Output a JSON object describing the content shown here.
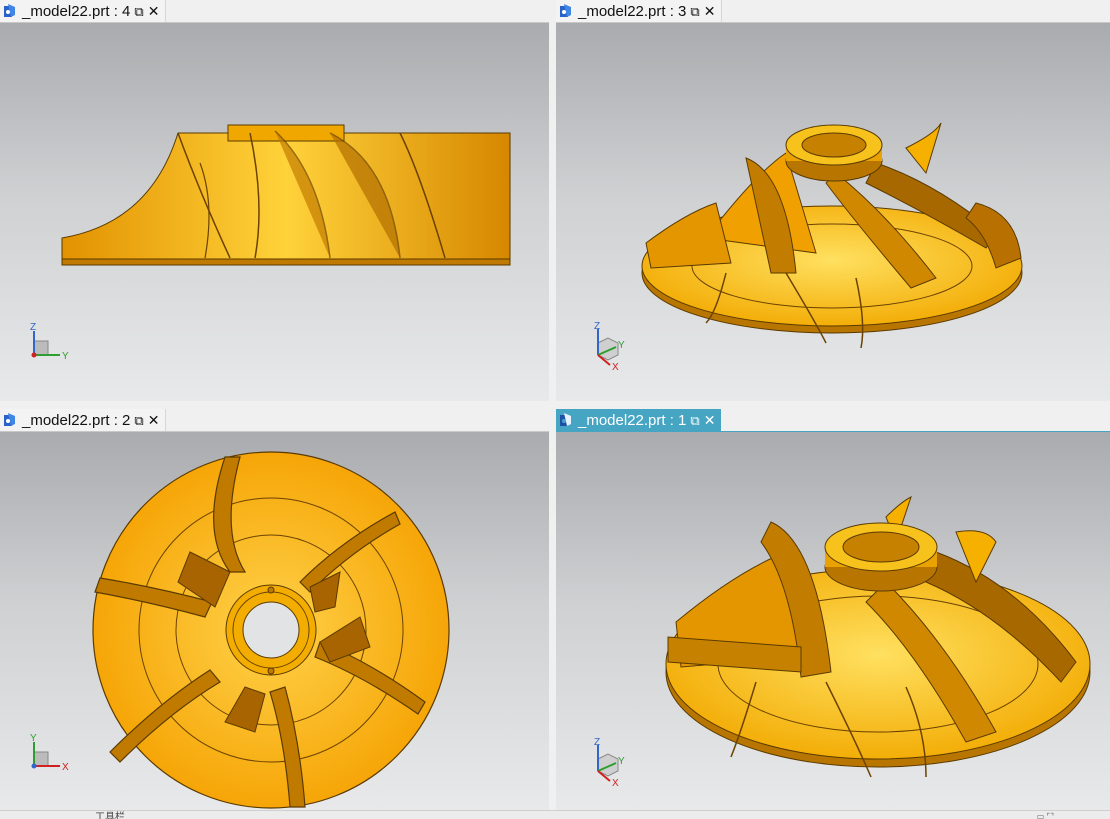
{
  "panes": [
    {
      "tab_title": "_model22.prt : 4",
      "active": false,
      "view": "side",
      "triad_axes": [
        "Z",
        "Y"
      ]
    },
    {
      "tab_title": "_model22.prt : 3",
      "active": false,
      "view": "iso",
      "triad_axes": [
        "Z",
        "Y",
        "X"
      ]
    },
    {
      "tab_title": "_model22.prt : 2",
      "active": false,
      "view": "top",
      "triad_axes": [
        "Y",
        "X"
      ]
    },
    {
      "tab_title": "_model22.prt : 1",
      "active": true,
      "view": "iso",
      "triad_axes": [
        "Z",
        "Y",
        "X"
      ]
    }
  ],
  "icons": {
    "document": "part-document-icon",
    "popout": "popout-icon",
    "close": "close-icon"
  },
  "colors": {
    "active_tab": "#46a5c2",
    "model_gold": "#f5b800",
    "model_shadow": "#b36f00",
    "model_light": "#ffd64a",
    "background_top": "#a9abae",
    "background_bottom": "#e8e9ea",
    "axis_z": "#3366cc",
    "axis_y": "#2e9e2e",
    "axis_x": "#d02020"
  },
  "status": {
    "text": "工具栏"
  }
}
